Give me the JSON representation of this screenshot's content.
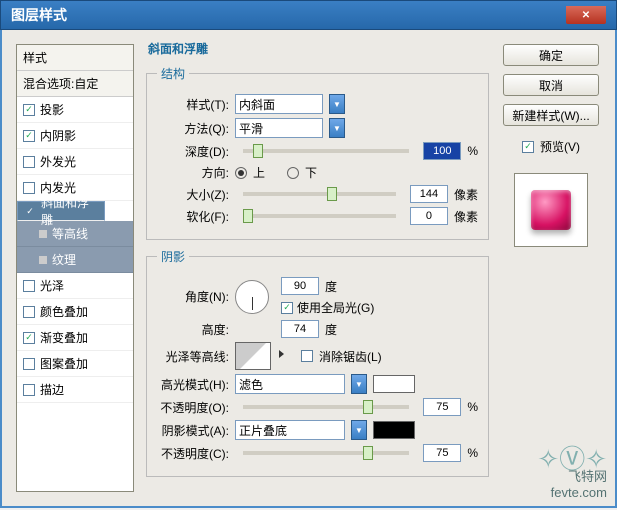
{
  "title": "图层样式",
  "buttons": {
    "ok": "确定",
    "cancel": "取消",
    "newStyle": "新建样式(W)...",
    "preview": "预览(V)"
  },
  "styles": {
    "hdr1": "样式",
    "hdr2": "混合选项:自定",
    "items": [
      {
        "label": "投影",
        "chk": true
      },
      {
        "label": "内阴影",
        "chk": true
      },
      {
        "label": "外发光",
        "chk": false
      },
      {
        "label": "内发光",
        "chk": false
      },
      {
        "label": "斜面和浮雕",
        "chk": true,
        "sel": true
      },
      {
        "label": "等高线",
        "sub": true
      },
      {
        "label": "纹理",
        "sub": true
      },
      {
        "label": "光泽",
        "chk": false
      },
      {
        "label": "颜色叠加",
        "chk": false
      },
      {
        "label": "渐变叠加",
        "chk": true
      },
      {
        "label": "图案叠加",
        "chk": false
      },
      {
        "label": "描边",
        "chk": false
      }
    ]
  },
  "panelTitle": "斜面和浮雕",
  "struct": {
    "legend": "结构",
    "styleLbl": "样式(T):",
    "styleVal": "内斜面",
    "methodLbl": "方法(Q):",
    "methodVal": "平滑",
    "depthLbl": "深度(D):",
    "depthVal": "100",
    "pct": "%",
    "dirLbl": "方向:",
    "up": "上",
    "down": "下",
    "sizeLbl": "大小(Z):",
    "sizeVal": "144",
    "px": "像素",
    "softLbl": "软化(F):",
    "softVal": "0"
  },
  "shade": {
    "legend": "阴影",
    "angleLbl": "角度(N):",
    "angleVal": "90",
    "deg": "度",
    "globalLbl": "使用全局光(G)",
    "altLbl": "高度:",
    "altVal": "74",
    "contourLbl": "光泽等高线:",
    "antiLbl": "消除锯齿(L)",
    "hiLbl": "高光模式(H):",
    "hiVal": "滤色",
    "opLbl": "不透明度(O):",
    "opVal": "75",
    "shLbl": "阴影模式(A):",
    "shVal": "正片叠底",
    "op2Lbl": "不透明度(C):",
    "op2Val": "75",
    "pct": "%"
  },
  "watermark": {
    "site": "飞特网",
    "url": "fevte.com"
  }
}
